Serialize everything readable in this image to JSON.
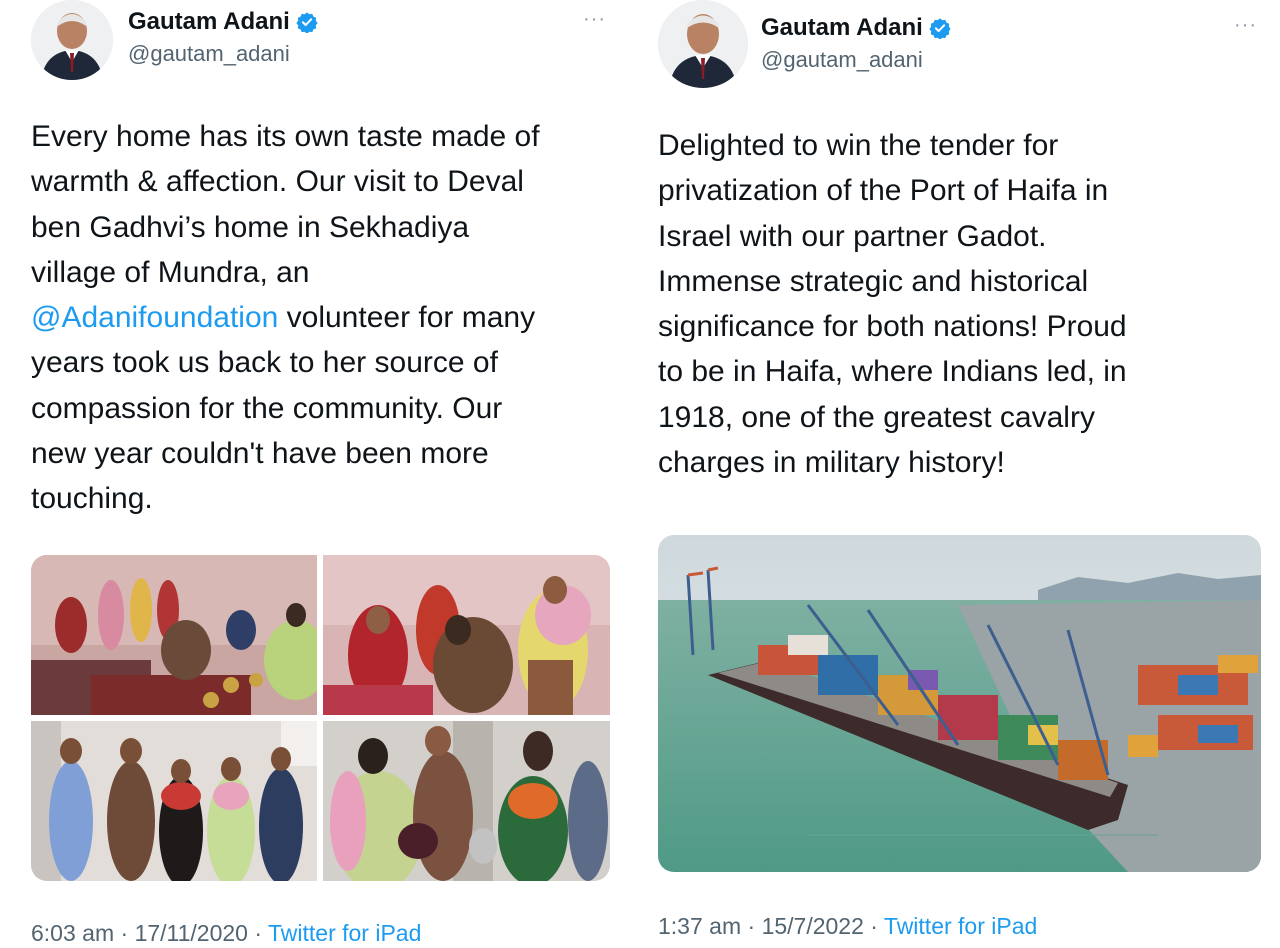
{
  "tweets": [
    {
      "author_name": "Gautam Adani",
      "handle": "@gautam_adani",
      "more_label": "···",
      "text_before_mention": "Every home has its own taste made of\nwarmth & affection. Our visit to Deval\nben Gadhvi’s home in Sekhadiya\nvillage of Mundra, an\n",
      "mention": "@Adanifoundation",
      "text_after_mention": " volunteer for many\nyears took us back to her source of\ncompassion for the community. Our\nnew year couldn't have been more\ntouching.",
      "time": "6:03 am",
      "separator": " · ",
      "date": "17/11/2020",
      "source": "Twitter for iPad",
      "photo_count": 4
    },
    {
      "author_name": "Gautam Adani",
      "handle": "@gautam_adani",
      "more_label": "···",
      "text": "Delighted to win the tender for\nprivatization of the Port of Haifa in\nIsrael with our partner Gadot.\nImmense strategic and historical\nsignificance for both nations! Proud\nto be in Haifa, where Indians led, in\n1918, one of the greatest cavalry\ncharges in military history!",
      "time": "1:37 am",
      "separator": " · ",
      "date": "15/7/2022",
      "source": "Twitter for iPad",
      "photo_count": 1
    }
  ],
  "colors": {
    "text": "#0f1419",
    "secondary": "#536471",
    "link": "#1d9bf0",
    "verified_badge": "#1d9bf0"
  },
  "icons": {
    "verified": "verified-badge-icon",
    "more": "more-options-icon"
  }
}
